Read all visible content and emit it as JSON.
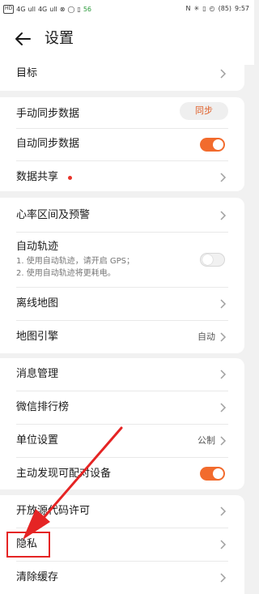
{
  "status_bar": {
    "left": [
      "HD",
      "4G",
      "ull",
      "4G",
      "ull",
      "⊗",
      "◯",
      "▯",
      "56"
    ],
    "right": [
      "N",
      "✳",
      "▯",
      "◴",
      "(85)",
      "9:57"
    ]
  },
  "header": {
    "title": "设置",
    "back_icon": "back-arrow-icon"
  },
  "groups": {
    "g1": {
      "goal": "目标"
    },
    "g2": {
      "manual_sync": "手动同步数据",
      "sync_button": "同步",
      "auto_sync": "自动同步数据",
      "auto_sync_on": true,
      "data_share": "数据共享"
    },
    "g3": {
      "heart_rate": "心率区间及预警",
      "auto_track": "自动轨迹",
      "auto_track_desc1": "1. 使用自动轨迹，请开启 GPS；",
      "auto_track_desc2": "2. 使用自动轨迹将更耗电。",
      "auto_track_on": false,
      "offline_map": "离线地图",
      "map_engine": "地图引擎",
      "map_engine_value": "自动"
    },
    "g4": {
      "message_mgmt": "消息管理",
      "wechat_rank": "微信排行榜",
      "unit_settings": "单位设置",
      "unit_value": "公制",
      "discover_device": "主动发现可配对设备",
      "discover_on": true
    },
    "g5": {
      "open_source": "开放源代码许可",
      "privacy": "隐私",
      "clear_cache": "清除缓存"
    }
  },
  "colors": {
    "accent": "#f26b2d",
    "annotation": "#e52424"
  }
}
